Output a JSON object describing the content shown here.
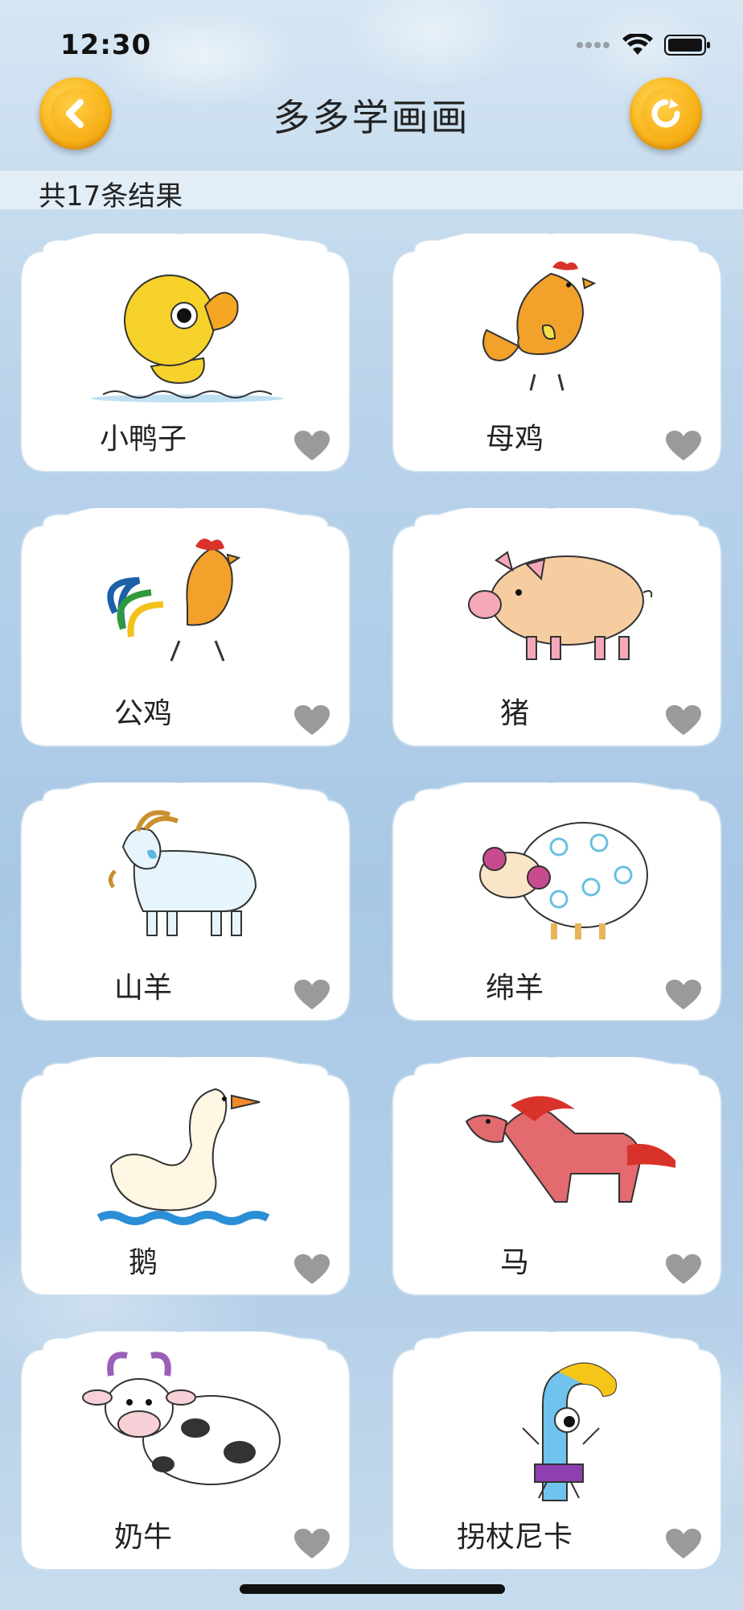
{
  "status_bar": {
    "time": "12:30"
  },
  "header": {
    "title": "多多学画画"
  },
  "results": {
    "count_text": "共17条结果"
  },
  "items": [
    {
      "label": "小鸭子",
      "favorite": false
    },
    {
      "label": "母鸡",
      "favorite": false
    },
    {
      "label": "公鸡",
      "favorite": false
    },
    {
      "label": "猪",
      "favorite": false
    },
    {
      "label": "山羊",
      "favorite": false
    },
    {
      "label": "绵羊",
      "favorite": false
    },
    {
      "label": "鹅",
      "favorite": false
    },
    {
      "label": "马",
      "favorite": false
    },
    {
      "label": "奶牛",
      "favorite": false
    },
    {
      "label": "拐杖尼卡",
      "favorite": false
    }
  ],
  "colors": {
    "accent": "#f9b61b",
    "heart": "#9a9a9a",
    "card": "#ffffff"
  }
}
